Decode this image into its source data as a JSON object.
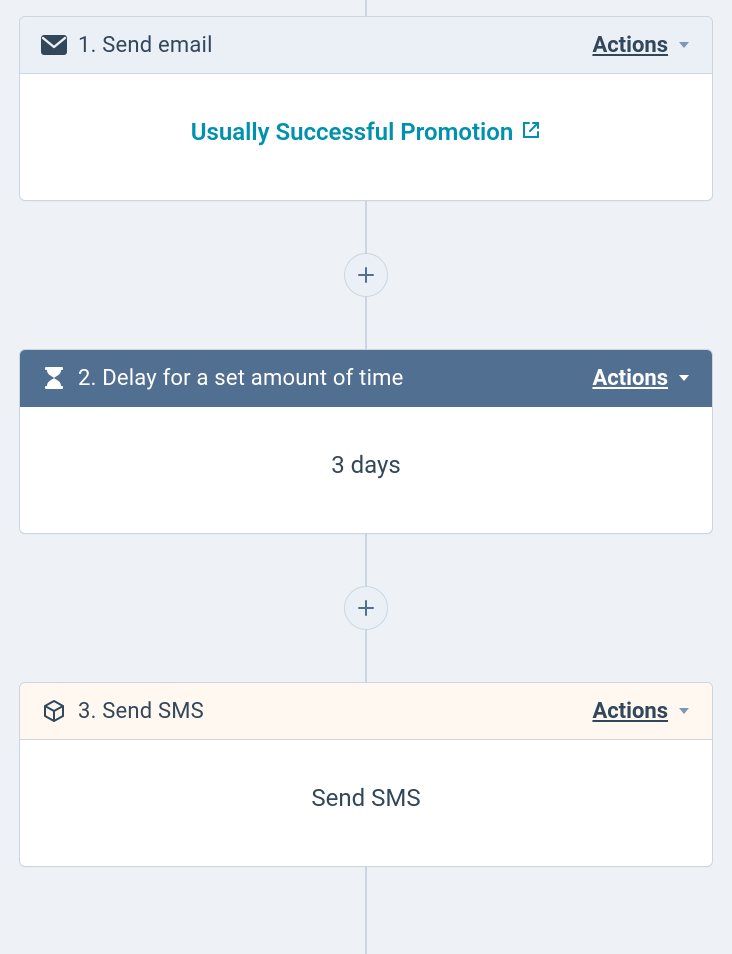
{
  "steps": [
    {
      "number": "1.",
      "title": "Send email",
      "actions_label": "Actions",
      "header_style": "light",
      "icon": "email",
      "body": {
        "kind": "link",
        "text": "Usually Successful Promotion"
      }
    },
    {
      "number": "2.",
      "title": "Delay for a set amount of time",
      "actions_label": "Actions",
      "header_style": "dark",
      "icon": "hourglass",
      "body": {
        "kind": "plain",
        "text": "3 days"
      }
    },
    {
      "number": "3.",
      "title": "Send SMS",
      "actions_label": "Actions",
      "header_style": "peach",
      "icon": "cube",
      "body": {
        "kind": "plain",
        "text": "Send SMS"
      }
    }
  ],
  "add_button_label": "+"
}
